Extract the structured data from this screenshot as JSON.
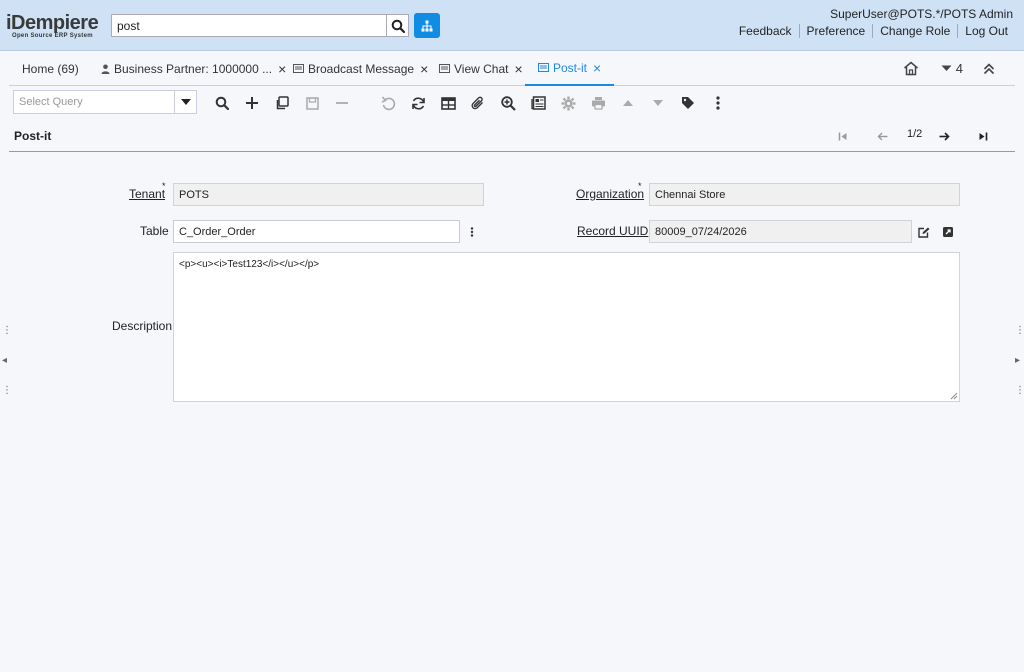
{
  "header": {
    "logo_text": "iDempiere",
    "logo_subtext": "Open Source ERP System",
    "search_value": "post",
    "user": "SuperUser@POTS.*/POTS Admin",
    "links": [
      "Feedback",
      "Preference",
      "Change Role",
      "Log Out"
    ]
  },
  "tabs": [
    {
      "label": "Home (69)",
      "icon": "none"
    },
    {
      "label": "Business Partner: 1000000 ...",
      "icon": "person-icon"
    },
    {
      "label": "Broadcast Message",
      "icon": "form-icon"
    },
    {
      "label": "View Chat",
      "icon": "form-icon"
    },
    {
      "label": "Post-it",
      "icon": "form-icon",
      "active": true
    }
  ],
  "tabbar_right": {
    "count": "4"
  },
  "toolbar": {
    "query_placeholder": "Select Query"
  },
  "window": {
    "title": "Post-it",
    "record_count": "1/2"
  },
  "form": {
    "tenant_label": "Tenant",
    "tenant_value": "POTS",
    "organization_label": "Organization",
    "organization_value": "Chennai Store",
    "table_label": "Table",
    "table_value": "C_Order_Order",
    "record_uuid_label": "Record UUID",
    "record_uuid_value": "80009_07/24/2026",
    "description_label": "Description",
    "description_value": "<p><u><i>Test123</i></u></p>"
  },
  "colors": {
    "header_bg": "#cfe2f5",
    "accent": "#1e88e5",
    "tree_button": "#0e8de3"
  }
}
